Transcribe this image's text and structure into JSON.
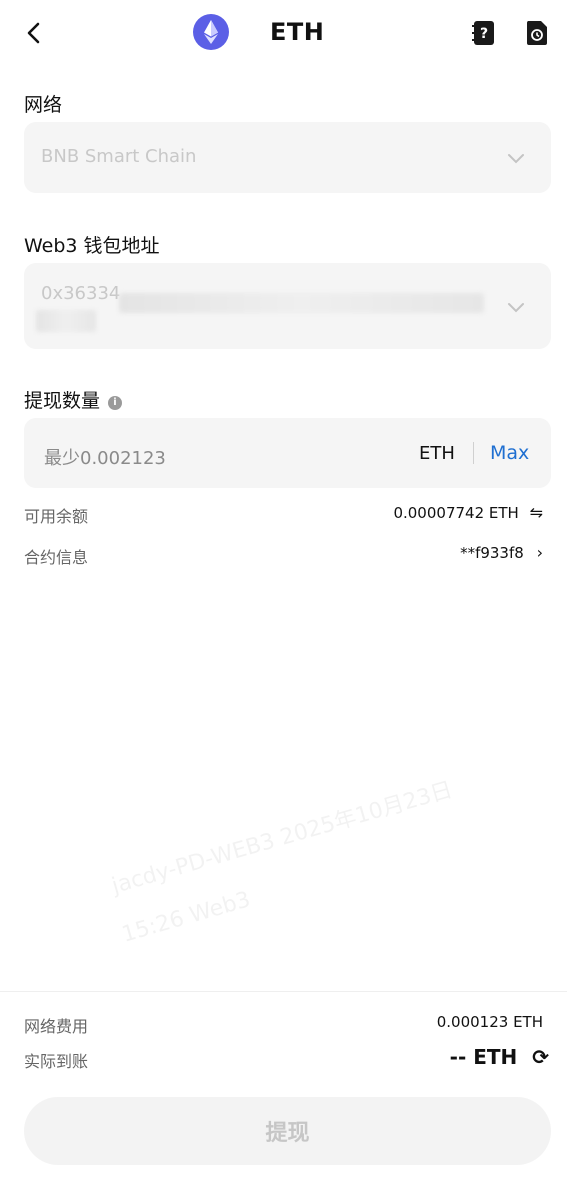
{
  "header": {
    "back_icon": "chevron-left-icon",
    "coin_icon": "ethereum-icon",
    "title": "ETH",
    "help_icon": "help-book-icon",
    "history_icon": "history-icon"
  },
  "network": {
    "label": "网络",
    "value": "BNB Smart Chain"
  },
  "address": {
    "label": "Web3 钱包地址",
    "value": "0x36334"
  },
  "amount": {
    "label": "提现数量",
    "placeholder": "最少0.002123",
    "unit": "ETH",
    "max_label": "Max"
  },
  "available": {
    "label": "可用余额",
    "value": "0.00007742 ETH"
  },
  "contract": {
    "label": "合约信息",
    "value": "**f933f8"
  },
  "fee": {
    "label": "网络费用",
    "value": "0.000123 ETH"
  },
  "received": {
    "label": "实际到账",
    "value": "-- ETH"
  },
  "submit_label": "提现",
  "watermark": {
    "line1": "jacdy-PD-WEB3 2025年10月23日",
    "line2": "15:26 Web3"
  },
  "colors": {
    "accent": "#1f6fd1",
    "coin": "#5b5fe6",
    "field_bg": "#f5f5f5"
  }
}
